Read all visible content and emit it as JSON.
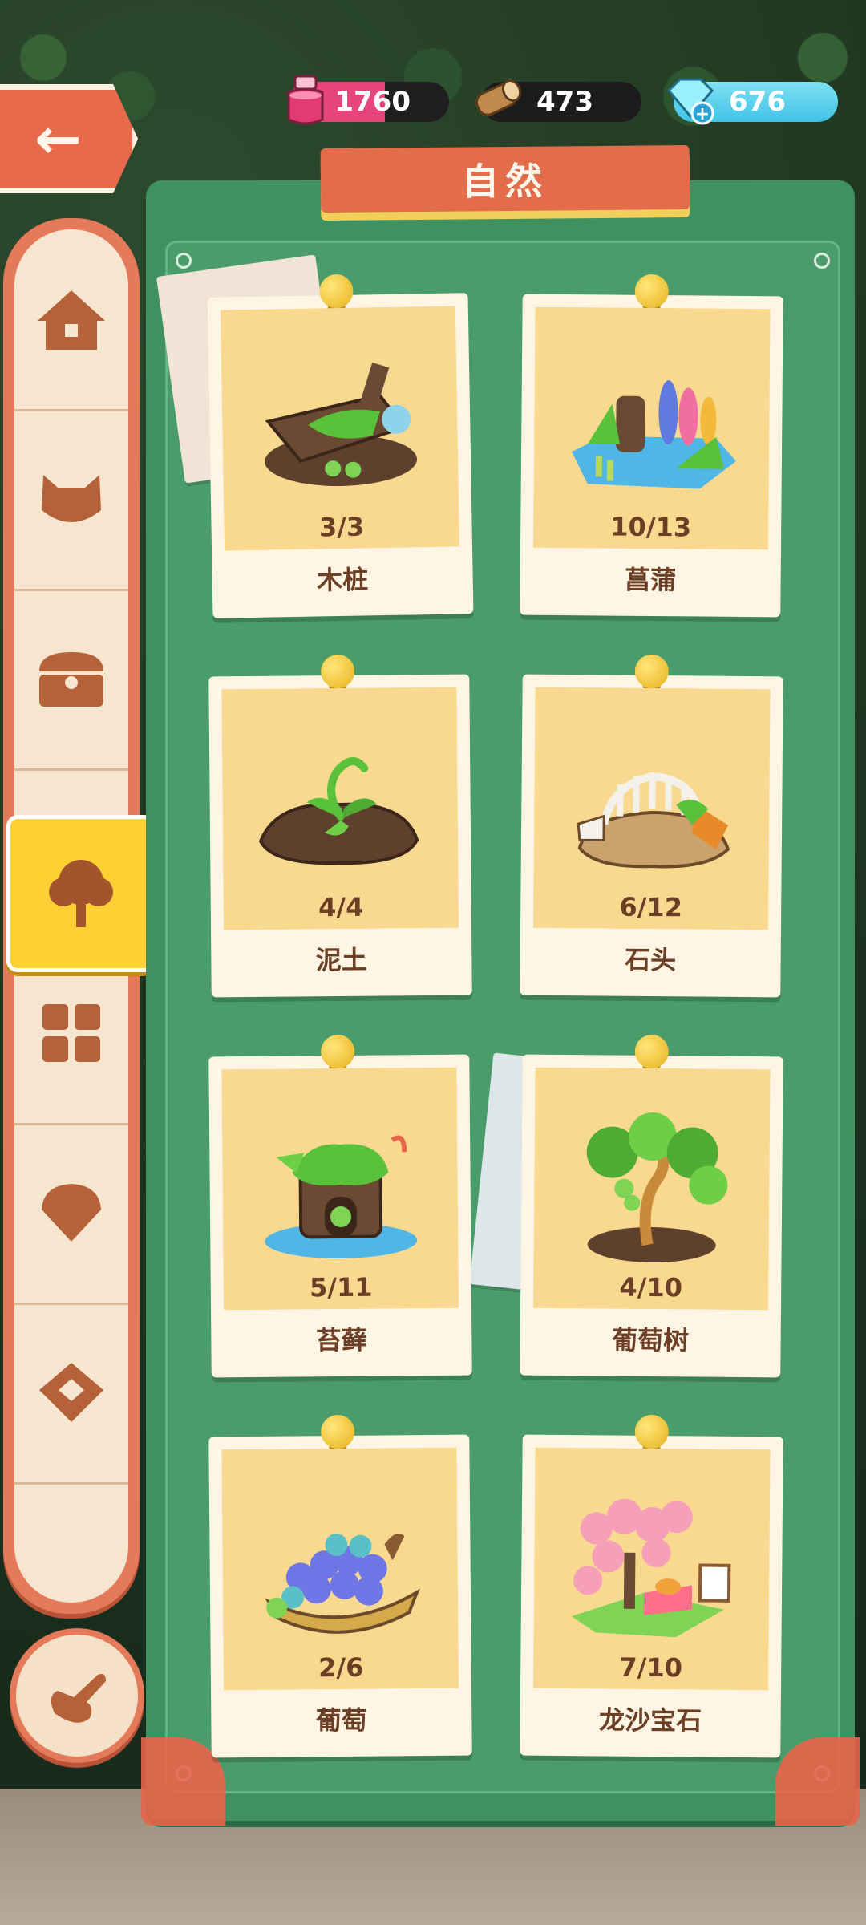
{
  "resources": {
    "ink": "1760",
    "wood": "473",
    "gems": "676"
  },
  "title": "自然",
  "tabs": [
    {
      "icon": "house-icon"
    },
    {
      "icon": "cat-icon"
    },
    {
      "icon": "chest-icon"
    },
    {
      "icon": "tree-icon",
      "active": true
    },
    {
      "icon": "grid-icon"
    },
    {
      "icon": "shell-icon"
    },
    {
      "icon": "tag-icon"
    }
  ],
  "cards": [
    {
      "label": "木桩",
      "count": "3/3"
    },
    {
      "label": "菖蒲",
      "count": "10/13"
    },
    {
      "label": "泥土",
      "count": "4/4"
    },
    {
      "label": "石头",
      "count": "6/12"
    },
    {
      "label": "苔藓",
      "count": "5/11"
    },
    {
      "label": "葡萄树",
      "count": "4/10"
    },
    {
      "label": "葡萄",
      "count": "2/6"
    },
    {
      "label": "龙沙宝石",
      "count": "7/10"
    }
  ],
  "colors": {
    "panel": "#3f9160",
    "accent": "#e36c4b",
    "card_bg": "#f8d98f",
    "active_tab": "#ffd033"
  }
}
